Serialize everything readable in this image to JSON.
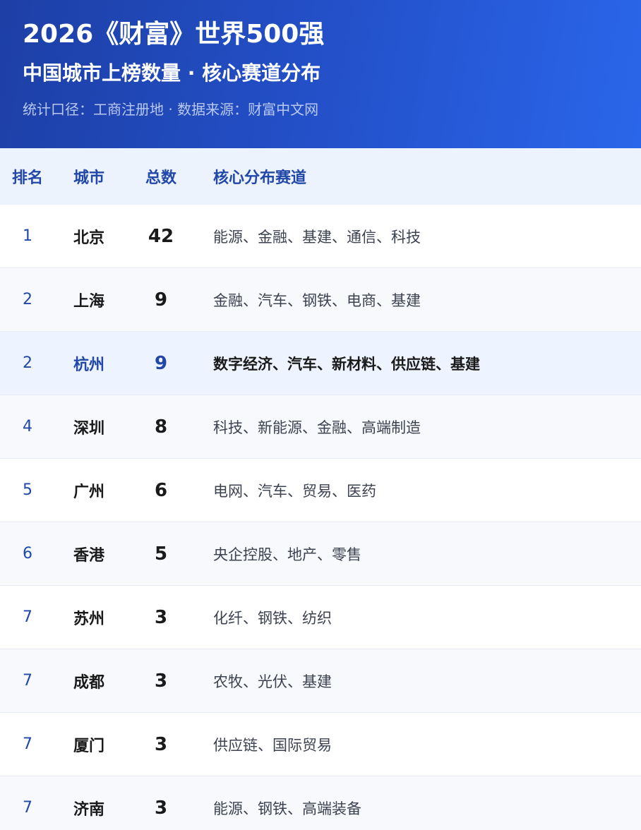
{
  "header": {
    "title": "2026《财富》世界500强",
    "subtitle": "中国城市上榜数量 · 核心赛道分布",
    "note": "统计口径：工商注册地 · 数据来源：财富中文网"
  },
  "table": {
    "columns": [
      "排名",
      "城市",
      "总数",
      "核心分布赛道"
    ],
    "rows": [
      {
        "rank": "1",
        "city": "北京",
        "total": "42",
        "sectors": "能源、金融、基建、通信、科技"
      },
      {
        "rank": "2",
        "city": "上海",
        "total": "9",
        "sectors": "金融、汽车、钢铁、电商、基建"
      },
      {
        "rank": "2",
        "city": "杭州",
        "total": "9",
        "sectors": "数字经济、汽车、新材料、供应链、基建"
      },
      {
        "rank": "4",
        "city": "深圳",
        "total": "8",
        "sectors": "科技、新能源、金融、高端制造"
      },
      {
        "rank": "5",
        "city": "广州",
        "total": "6",
        "sectors": "电网、汽车、贸易、医药"
      },
      {
        "rank": "6",
        "city": "香港",
        "total": "5",
        "sectors": "央企控股、地产、零售"
      },
      {
        "rank": "7",
        "city": "苏州",
        "total": "3",
        "sectors": "化纤、钢铁、纺织"
      },
      {
        "rank": "7",
        "city": "成都",
        "total": "3",
        "sectors": "农牧、光伏、基建"
      },
      {
        "rank": "7",
        "city": "厦门",
        "total": "3",
        "sectors": "供应链、国际贸易"
      },
      {
        "rank": "7",
        "city": "济南",
        "total": "3",
        "sectors": "能源、钢铁、高端装备"
      }
    ]
  },
  "colors": {
    "header_start": "#1d3fa6",
    "header_end": "#2a66ea",
    "accent": "#2147a8",
    "highlight_row": "#eef4ff"
  }
}
